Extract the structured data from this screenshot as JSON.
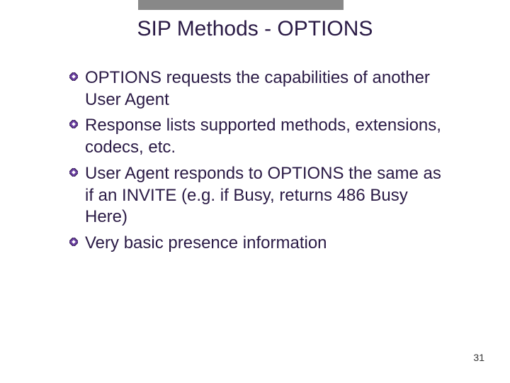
{
  "title": "SIP Methods - OPTIONS",
  "bullets": [
    "OPTIONS requests the capabilities of another User Agent",
    "Response lists supported methods, extensions, codecs, etc.",
    "User Agent responds to OPTIONS the same as if an INVITE (e.g. if Busy, returns 486 Busy Here)",
    "Very basic presence information"
  ],
  "page_number": "31",
  "colors": {
    "accent": "#6a3fa0",
    "text": "#2a1a45",
    "topbar": "#888888"
  }
}
